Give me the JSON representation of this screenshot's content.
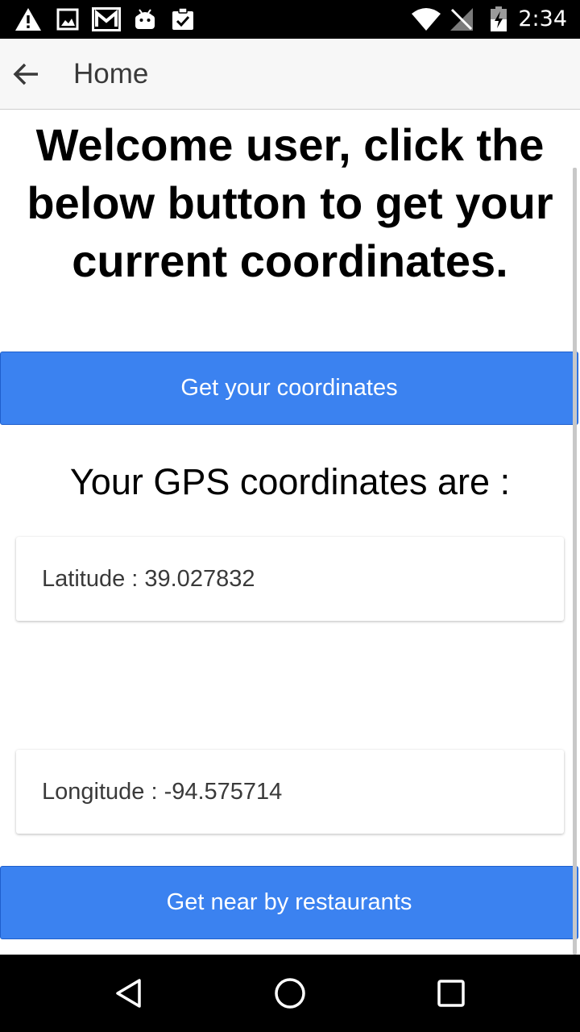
{
  "status_bar": {
    "time": "2:34",
    "left_icons": [
      "warning-icon",
      "image-icon",
      "gmail-icon",
      "android-icon",
      "clipboard-check-icon"
    ],
    "right_icons": [
      "wifi-icon",
      "no-signal-icon",
      "battery-icon"
    ]
  },
  "app_bar": {
    "title": "Home",
    "back_icon": "arrow-back-icon"
  },
  "main": {
    "welcome_text": "Welcome user, click the below button to get your current coordinates.",
    "get_coordinates_label": "Get your coordinates",
    "gps_heading": "Your GPS coordinates are :",
    "latitude_text": "Latitude : 39.027832",
    "longitude_text": "Longitude : -94.575714",
    "restaurants_label": "Get near by restaurants"
  },
  "nav_bar": {
    "icons": [
      "back-triangle-icon",
      "home-circle-icon",
      "recents-square-icon"
    ]
  },
  "colors": {
    "primary_button": "#3b82f0",
    "status_bar": "#000000",
    "app_bar": "#f7f7f7"
  }
}
